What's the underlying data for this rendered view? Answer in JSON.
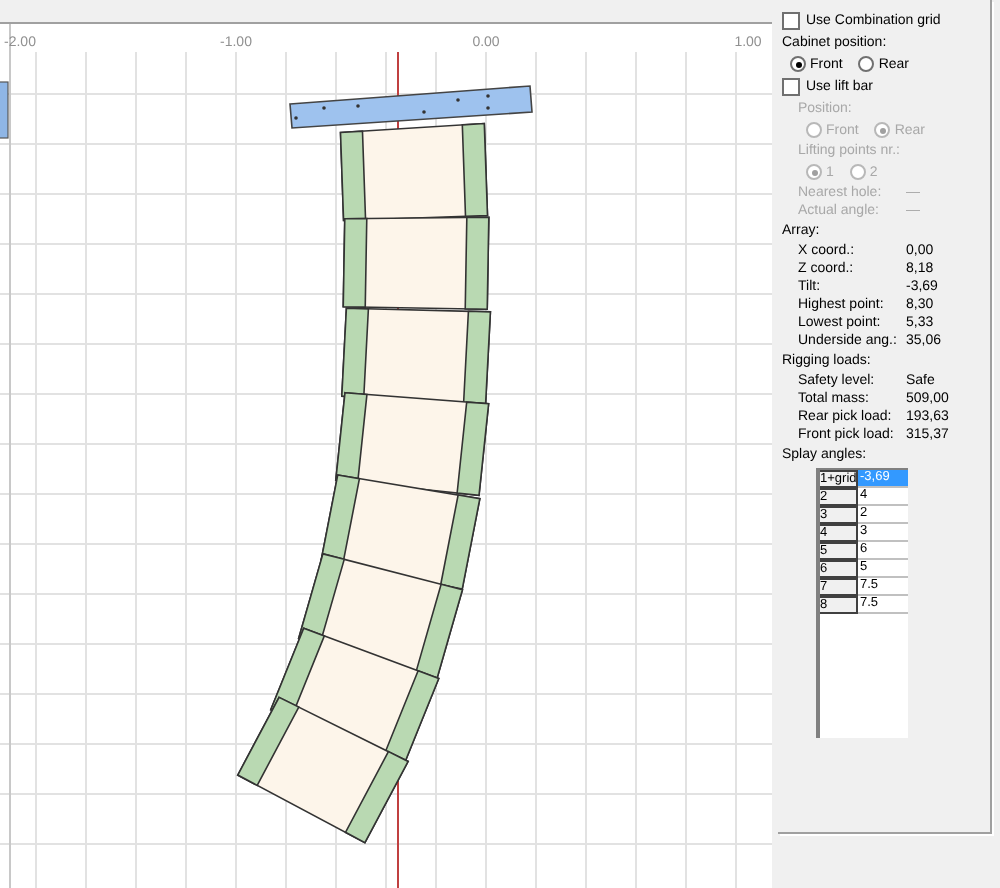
{
  "axis_labels": [
    "-2.00",
    "-1.00",
    "0.00",
    "1.00"
  ],
  "panel": {
    "combination_grid": {
      "label": "Use Combination grid",
      "checked": false
    },
    "cabinet_position": {
      "title": "Cabinet position:",
      "options": [
        {
          "label": "Front",
          "selected": true
        },
        {
          "label": "Rear",
          "selected": false
        }
      ]
    },
    "lift_bar": {
      "label": "Use lift bar",
      "checked": false,
      "disabled": true,
      "position": {
        "title": "Position:",
        "options": [
          {
            "label": "Front",
            "selected": false
          },
          {
            "label": "Rear",
            "selected": true
          }
        ]
      },
      "lifting_points": {
        "title": "Lifting points nr.:",
        "options": [
          {
            "label": "1",
            "selected": true
          },
          {
            "label": "2",
            "selected": false
          }
        ]
      },
      "readings": [
        {
          "label": "Nearest hole:",
          "value": "—"
        },
        {
          "label": "Actual angle:",
          "value": "—"
        }
      ]
    },
    "array": {
      "title": "Array:",
      "rows": [
        {
          "label": "X coord.:",
          "value": "0,00"
        },
        {
          "label": "Z coord.:",
          "value": "8,18"
        },
        {
          "label": "Tilt:",
          "value": "-3,69"
        },
        {
          "label": "Highest point:",
          "value": "8,30"
        },
        {
          "label": "Lowest point:",
          "value": "5,33"
        },
        {
          "label": "Underside ang.:",
          "value": "35,06"
        }
      ]
    },
    "rigging": {
      "title": "Rigging loads:",
      "rows": [
        {
          "label": "Safety level:",
          "value": "Safe"
        },
        {
          "label": "Total mass:",
          "value": "509,00"
        },
        {
          "label": "Rear pick load:",
          "value": "193,63"
        },
        {
          "label": "Front pick load:",
          "value": "315,37"
        }
      ]
    },
    "splay": {
      "title": "Splay angles:",
      "rows": [
        {
          "index": "1+grid",
          "angle": "-3,69",
          "selected": true
        },
        {
          "index": "2",
          "angle": "4",
          "selected": false
        },
        {
          "index": "3",
          "angle": "2",
          "selected": false
        },
        {
          "index": "4",
          "angle": "3",
          "selected": false
        },
        {
          "index": "5",
          "angle": "6",
          "selected": false
        },
        {
          "index": "6",
          "angle": "5",
          "selected": false
        },
        {
          "index": "7",
          "angle": "7.5",
          "selected": false
        },
        {
          "index": "8",
          "angle": "7.5",
          "selected": false
        }
      ]
    }
  }
}
